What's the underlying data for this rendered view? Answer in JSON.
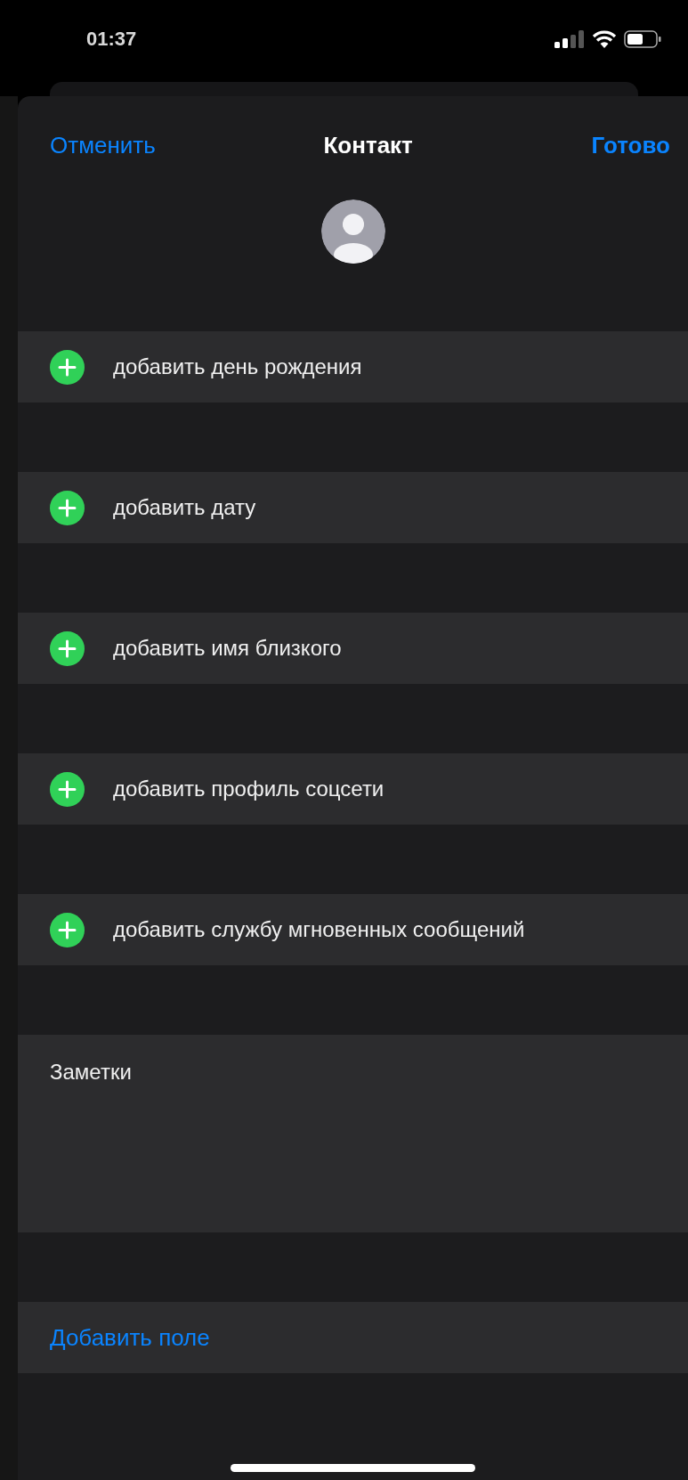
{
  "status_bar": {
    "time": "01:37"
  },
  "nav": {
    "cancel": "Отменить",
    "title": "Контакт",
    "done": "Готово"
  },
  "add_rows": [
    {
      "label": "добавить день рождения"
    },
    {
      "label": "добавить дату"
    },
    {
      "label": "добавить имя близкого"
    },
    {
      "label": "добавить профиль соцсети"
    },
    {
      "label": "добавить службу мгновенных сообщений"
    }
  ],
  "notes": {
    "label": "Заметки"
  },
  "add_field": {
    "label": "Добавить поле"
  }
}
